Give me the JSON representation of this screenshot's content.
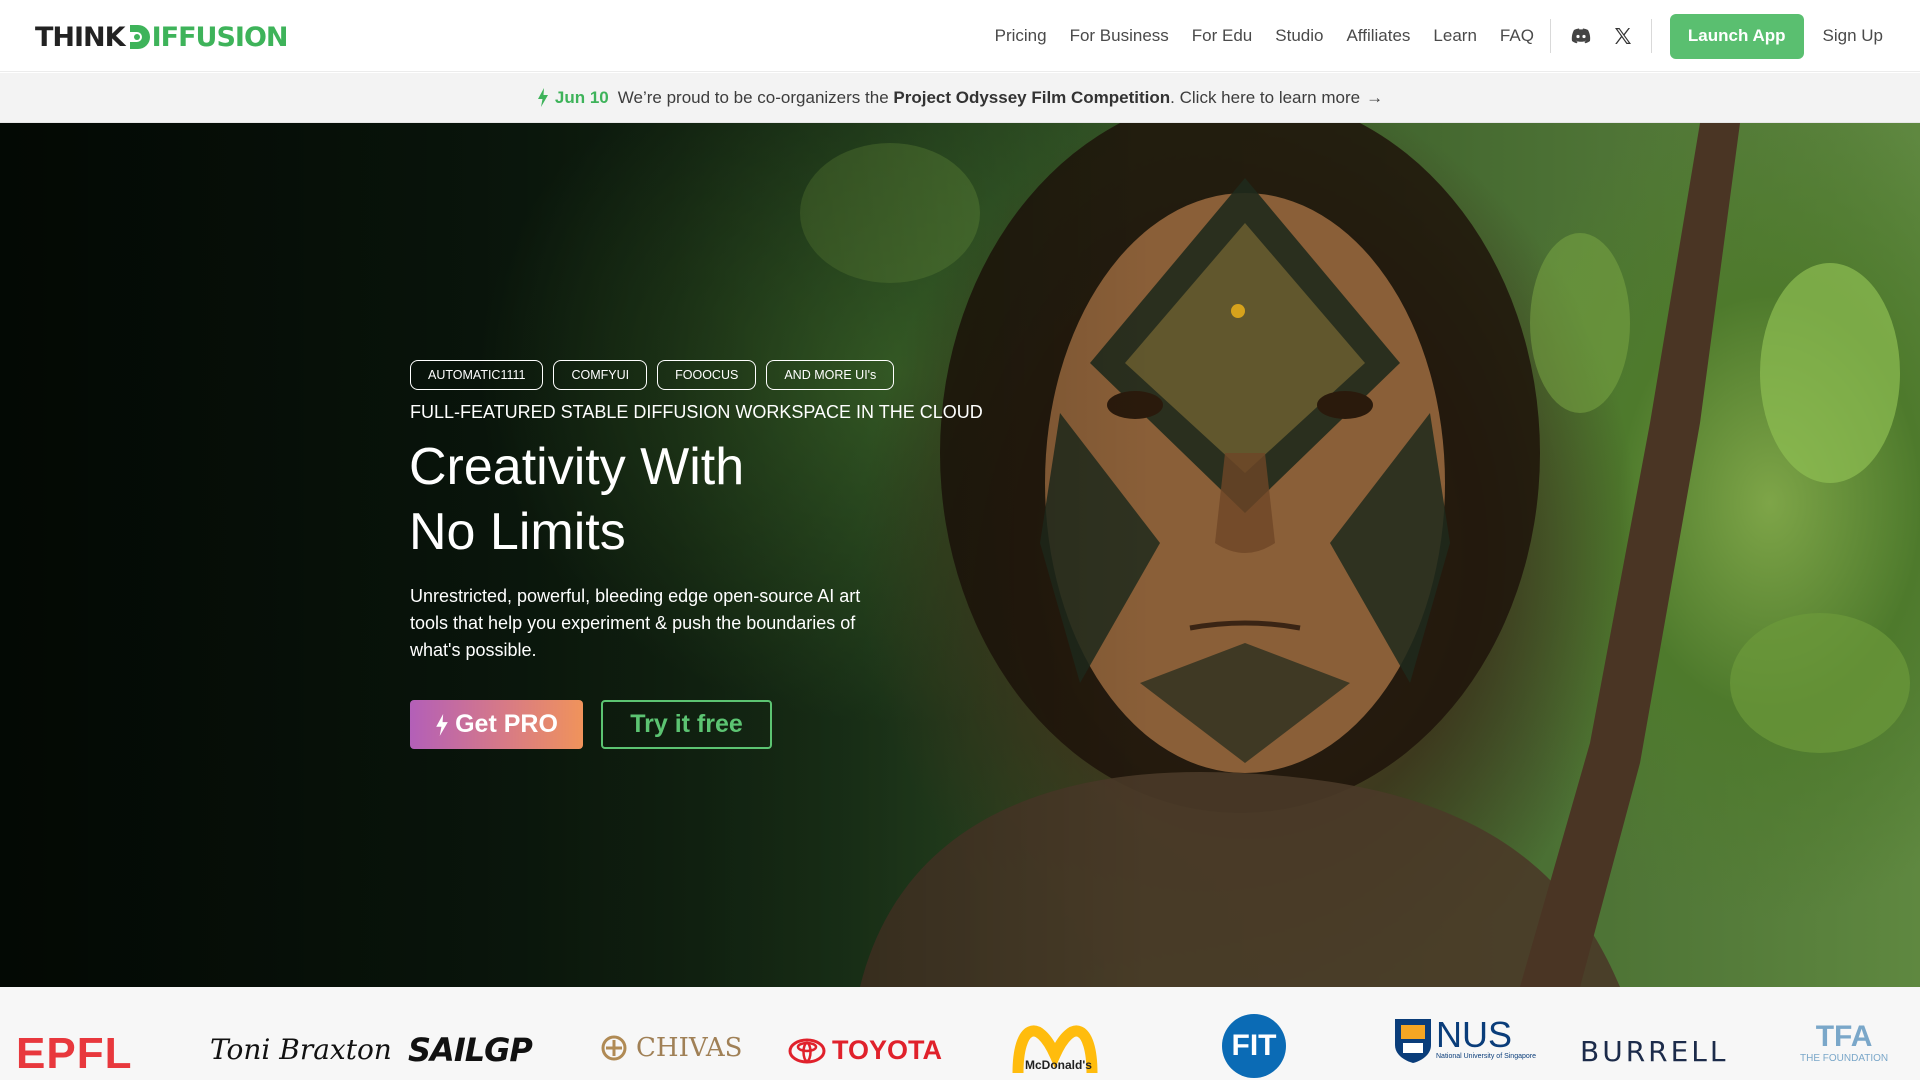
{
  "brand": {
    "think": "THINK",
    "diffusion": "IFFUSION",
    "accent": "#3eb35a"
  },
  "nav": {
    "links": [
      "Pricing",
      "For Business",
      "For Edu",
      "Studio",
      "Affiliates",
      "Learn",
      "FAQ"
    ],
    "icons": [
      "discord-icon",
      "x-twitter-icon"
    ],
    "launch_label": "Launch App",
    "signup_label": "Sign Up"
  },
  "announcement": {
    "date": "Jun 10",
    "text_before": "We’re proud to be co-organizers the ",
    "highlight": "Project Odyssey Film Competition",
    "text_after": ". Click here to learn more",
    "arrow": "→"
  },
  "hero": {
    "chips": [
      "AUTOMATIC1111",
      "COMFYUI",
      "FOOOCUS",
      "AND MORE UI's"
    ],
    "subtitle": "FULL-FEATURED STABLE DIFFUSION WORKSPACE IN THE CLOUD",
    "headline_line1": "Creativity With",
    "headline_line2": "No Limits",
    "description": "Unrestricted, powerful, bleeding edge open-source AI art tools that help you experiment & push the boundaries of what's possible.",
    "pro_label": "Get PRO",
    "free_label": "Try it free",
    "pro_gradient": [
      "#b35fb8",
      "#f0935b"
    ],
    "free_color": "#5cc472"
  },
  "logos": {
    "items": [
      "EPFL",
      "Toni Braxton",
      "SAILGP",
      "CHIVAS",
      "TOYOTA",
      "McDonald's",
      "FIT",
      "NUS",
      "BURRELL",
      "TFA"
    ],
    "nus_sub": "National University of Singapore",
    "tfa_sub": "THE FOUNDATION"
  }
}
